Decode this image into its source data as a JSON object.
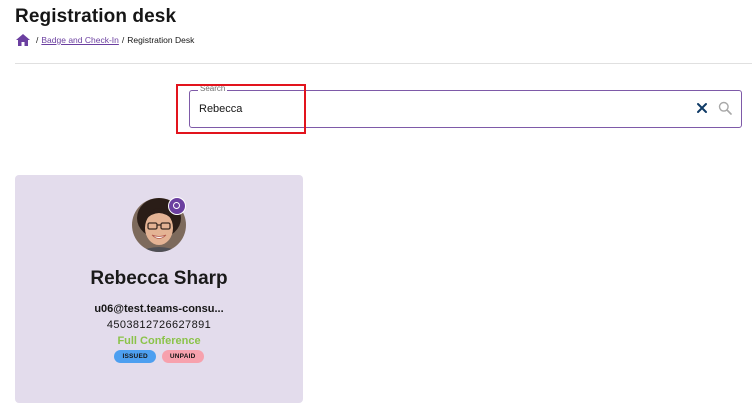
{
  "page": {
    "title": "Registration desk"
  },
  "breadcrumb": {
    "home_icon": "home-icon",
    "separator": "/",
    "items": [
      {
        "label": "Badge and Check-In",
        "link": true
      },
      {
        "label": "Registration Desk",
        "link": false
      }
    ]
  },
  "search": {
    "label": "Search",
    "value": "Rebecca",
    "clear_icon": "close-icon",
    "search_icon": "search-icon"
  },
  "attendee": {
    "name": "Rebecca Sharp",
    "email": "u06@test.teams-consu...",
    "id": "4503812726627891",
    "ticket": "Full Conference",
    "badges": [
      "ISSUED",
      "UNPAID"
    ]
  },
  "colors": {
    "accent": "#6b3fa0",
    "card_bg": "#e3dcec",
    "ticket_green": "#8bc34a",
    "issued": "#4d9ff0",
    "unpaid": "#f7a1ad",
    "highlight": "#e2141d"
  }
}
